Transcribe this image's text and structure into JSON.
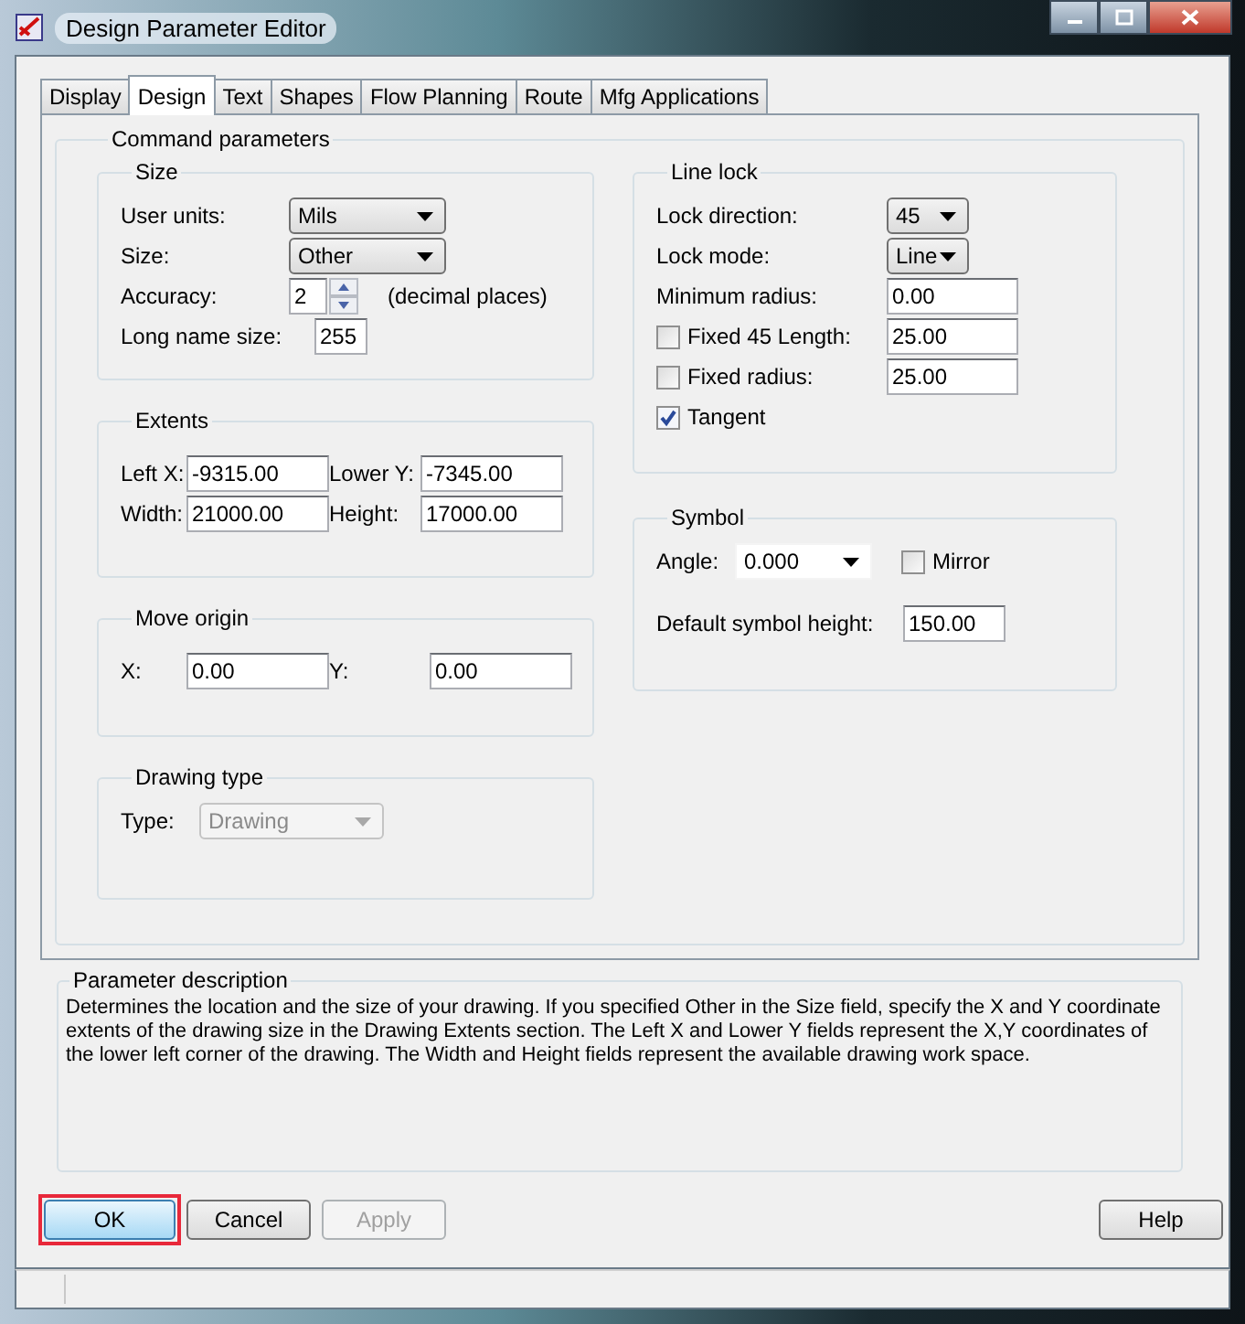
{
  "window": {
    "title": "Design Parameter Editor"
  },
  "tabs": [
    {
      "label": "Display",
      "selected": false
    },
    {
      "label": "Design",
      "selected": true
    },
    {
      "label": "Text",
      "selected": false
    },
    {
      "label": "Shapes",
      "selected": false
    },
    {
      "label": "Flow Planning",
      "selected": false
    },
    {
      "label": "Route",
      "selected": false
    },
    {
      "label": "Mfg Applications",
      "selected": false
    }
  ],
  "command_parameters": {
    "title": "Command parameters",
    "size": {
      "title": "Size",
      "user_units": {
        "label": "User units:",
        "value": "Mils"
      },
      "size": {
        "label": "Size:",
        "value": "Other"
      },
      "accuracy": {
        "label": "Accuracy:",
        "value": "2",
        "note": "(decimal places)"
      },
      "long_name_size": {
        "label": "Long name size:",
        "value": "255"
      }
    },
    "extents": {
      "title": "Extents",
      "fields": [
        {
          "label": "Left X:",
          "value": "-9315.00"
        },
        {
          "label": "Lower Y:",
          "value": "-7345.00"
        },
        {
          "label": "Width:",
          "value": "21000.00"
        },
        {
          "label": "Height:",
          "value": "17000.00"
        }
      ]
    },
    "move_origin": {
      "title": "Move origin",
      "fields": [
        {
          "label": "X:",
          "value": "0.00"
        },
        {
          "label": "Y:",
          "value": "0.00"
        }
      ]
    },
    "drawing_type": {
      "title": "Drawing type",
      "label": "Type:",
      "value": "Drawing",
      "disabled": true
    },
    "line_lock": {
      "title": "Line lock",
      "rows": [
        {
          "kind": "dropdown",
          "label": "Lock direction:",
          "value": "45"
        },
        {
          "kind": "dropdown",
          "label": "Lock mode:",
          "value": "Line"
        },
        {
          "kind": "field",
          "label": "Minimum radius:",
          "value": "0.00"
        },
        {
          "kind": "checkfield",
          "label": "Fixed 45 Length:",
          "checked": false,
          "value": "25.00"
        },
        {
          "kind": "checkfield",
          "label": "Fixed radius:",
          "checked": false,
          "value": "25.00"
        },
        {
          "kind": "checkbox",
          "label": "Tangent",
          "checked": true
        }
      ]
    },
    "symbol": {
      "title": "Symbol",
      "angle": {
        "label": "Angle:",
        "value": "0.000"
      },
      "mirror": {
        "label": "Mirror",
        "checked": false
      },
      "default_height": {
        "label": "Default symbol height:",
        "value": "150.00"
      }
    }
  },
  "parameter_description": {
    "title": "Parameter description",
    "text": "Determines the location and the size of your drawing. If you specified Other in the Size field, specify the X and Y coordinate extents of the drawing size in the Drawing Extents section. The Left X and Lower Y fields represent the X,Y coordinates of the lower left corner of the drawing. The Width and Height fields represent the available drawing work space."
  },
  "buttons": [
    {
      "label": "OK",
      "default": true,
      "disabled": false,
      "highlighted": true
    },
    {
      "label": "Cancel",
      "default": false,
      "disabled": false,
      "highlighted": false
    },
    {
      "label": "Apply",
      "default": false,
      "disabled": true,
      "highlighted": false
    }
  ],
  "help_button": {
    "label": "Help"
  }
}
